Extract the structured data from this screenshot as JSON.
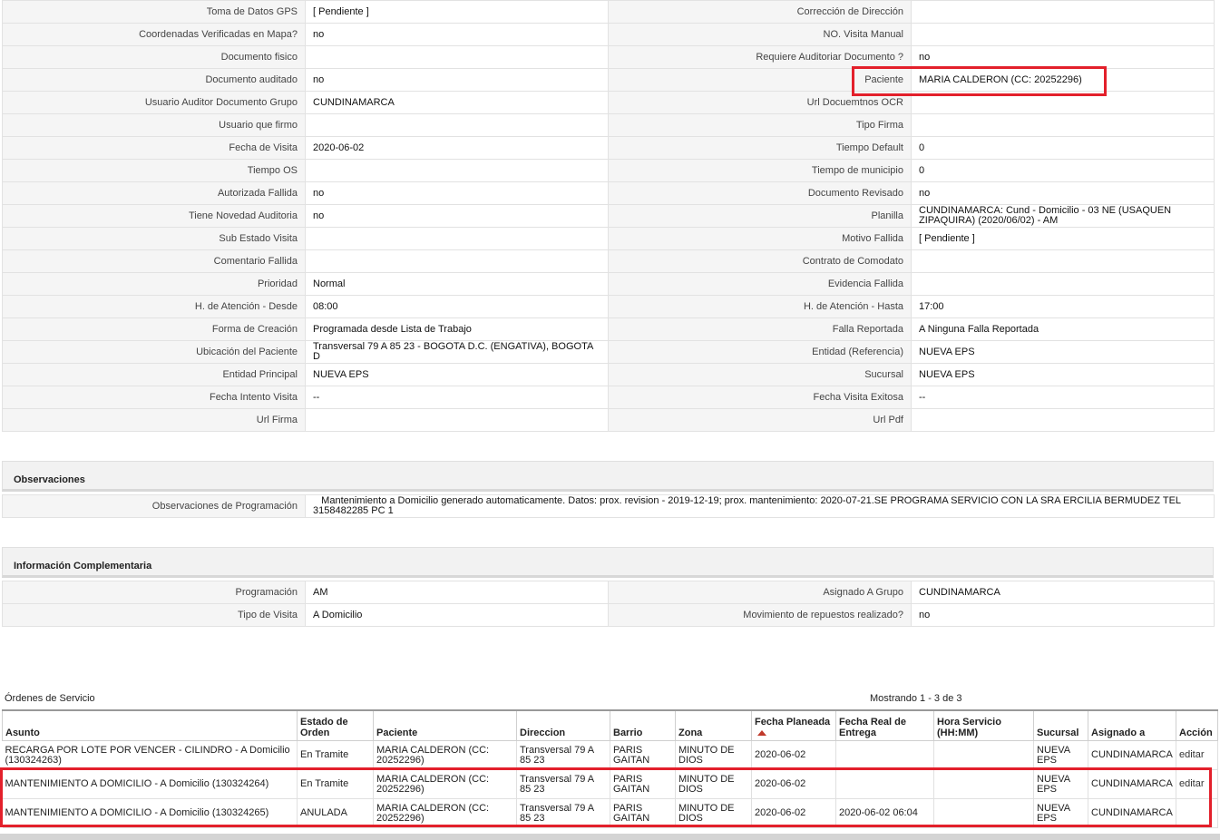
{
  "details": {
    "rows": [
      {
        "l1": "Toma de Datos GPS",
        "v1": "[ Pendiente ]",
        "l2": "Corrección de Dirección",
        "v2": ""
      },
      {
        "l1": "Coordenadas Verificadas en Mapa?",
        "v1": " no",
        "l2": "NO. Visita Manual",
        "v2": ""
      },
      {
        "l1": "Documento fisico",
        "v1": "",
        "l2": "Requiere Auditoriar Documento ?",
        "v2": " no"
      },
      {
        "l1": "Documento auditado",
        "v1": " no",
        "l2": "Paciente",
        "v2": "MARIA CALDERON (CC: 20252296)"
      },
      {
        "l1": "Usuario Auditor Documento Grupo",
        "v1": "CUNDINAMARCA",
        "l2": "Url Docuemtnos OCR",
        "v2": ""
      },
      {
        "l1": "Usuario que firmo",
        "v1": "",
        "l2": "Tipo Firma",
        "v2": ""
      },
      {
        "l1": "Fecha de Visita",
        "v1": " 2020-06-02",
        "l2": "Tiempo Default",
        "v2": "0"
      },
      {
        "l1": "Tiempo OS",
        "v1": "",
        "l2": "Tiempo de municipio",
        "v2": "0"
      },
      {
        "l1": "Autorizada Fallida",
        "v1": " no",
        "l2": "Documento Revisado",
        "v2": " no"
      },
      {
        "l1": "Tiene Novedad Auditoria",
        "v1": " no",
        "l2": "Planilla",
        "v2": "CUNDINAMARCA: Cund - Domicilio - 03 NE (USAQUEN ZIPAQUIRA) (2020/06/02) - AM"
      },
      {
        "l1": "Sub Estado Visita",
        "v1": "",
        "l2": "Motivo Fallida",
        "v2": "[ Pendiente ]"
      },
      {
        "l1": "Comentario Fallida",
        "v1": "",
        "l2": "Contrato de Comodato",
        "v2": ""
      },
      {
        "l1": "Prioridad",
        "v1": "Normal",
        "l2": "Evidencia Fallida",
        "v2": ""
      },
      {
        "l1": "H. de Atención - Desde",
        "v1": "08:00",
        "l2": "H. de Atención - Hasta",
        "v2": "17:00"
      },
      {
        "l1": "Forma de Creación",
        "v1": "Programada desde Lista de Trabajo",
        "l2": "Falla Reportada",
        "v2": "A Ninguna Falla Reportada"
      },
      {
        "l1": "Ubicación del Paciente",
        "v1": "Transversal 79 A 85 23 - BOGOTA D.C. (ENGATIVA), BOGOTA D",
        "l2": "Entidad (Referencia)",
        "v2": "NUEVA EPS"
      },
      {
        "l1": "Entidad Principal",
        "v1": "NUEVA EPS",
        "l2": "Sucursal",
        "v2": "NUEVA EPS"
      },
      {
        "l1": "Fecha Intento Visita",
        "v1": " --",
        "l2": "Fecha Visita Exitosa",
        "v2": " --"
      },
      {
        "l1": "Url Firma",
        "v1": "",
        "l2": "Url Pdf",
        "v2": ""
      }
    ]
  },
  "observaciones": {
    "title": "Observaciones",
    "label": "Observaciones de Programación",
    "value": "   Mantenimiento a Domicilio generado automaticamente. Datos: prox. revision - 2019-12-19; prox. mantenimiento: 2020-07-21.SE PROGRAMA SERVICIO CON LA SRA ERCILIA BERMUDEZ TEL 3158482285 PC 1"
  },
  "complementaria": {
    "title": "Información Complementaria",
    "rows": [
      {
        "l1": "Programación",
        "v1": "AM",
        "l2": "Asignado A Grupo",
        "v2": "CUNDINAMARCA"
      },
      {
        "l1": "Tipo de Visita",
        "v1": "A Domicilio",
        "l2": "Movimiento de repuestos realizado?",
        "v2": " no"
      }
    ]
  },
  "orders": {
    "title": "Órdenes de Servicio",
    "count": "Mostrando 1 - 3 de 3",
    "headers": [
      "Asunto",
      "Estado de Orden",
      "Paciente",
      "Direccion",
      "Barrio",
      "Zona",
      "Fecha Planeada",
      "Fecha Real de Entrega",
      "Hora Servicio (HH:MM)",
      "Sucursal",
      "Asignado a",
      "Acción"
    ],
    "rows": [
      {
        "asunto": "RECARGA POR LOTE POR VENCER - CILINDRO - A Domicilio (130324263)",
        "estado": "En Tramite",
        "paciente": "MARIA CALDERON (CC: 20252296)",
        "direccion": "Transversal 79 A 85 23",
        "barrio": "PARIS GAITAN",
        "zona": "MINUTO DE DIOS",
        "fecha_planeada": "2020-06-02",
        "fecha_real": "",
        "hora": "",
        "sucursal": "NUEVA EPS",
        "asignado": "CUNDINAMARCA",
        "accion": "editar"
      },
      {
        "asunto": "MANTENIMIENTO A DOMICILIO - A Domicilio (130324264)",
        "estado": "En Tramite",
        "paciente": "MARIA CALDERON (CC: 20252296)",
        "direccion": "Transversal 79 A 85 23",
        "barrio": "PARIS GAITAN",
        "zona": "MINUTO DE DIOS",
        "fecha_planeada": "2020-06-02",
        "fecha_real": "",
        "hora": "",
        "sucursal": "NUEVA EPS",
        "asignado": "CUNDINAMARCA",
        "accion": "editar"
      },
      {
        "asunto": "MANTENIMIENTO A DOMICILIO - A Domicilio (130324265)",
        "estado": "ANULADA",
        "paciente": "MARIA CALDERON (CC: 20252296)",
        "direccion": "Transversal 79 A 85 23",
        "barrio": "PARIS GAITAN",
        "zona": "MINUTO DE DIOS",
        "fecha_planeada": "2020-06-02",
        "fecha_real": "2020-06-02 06:04",
        "hora": "",
        "sucursal": "NUEVA EPS",
        "asignado": "CUNDINAMARCA",
        "accion": ""
      }
    ]
  },
  "colors": {
    "highlight": "#e3202b",
    "label_bg": "#f5f5f5",
    "sort_arrow": "#c0392b"
  }
}
